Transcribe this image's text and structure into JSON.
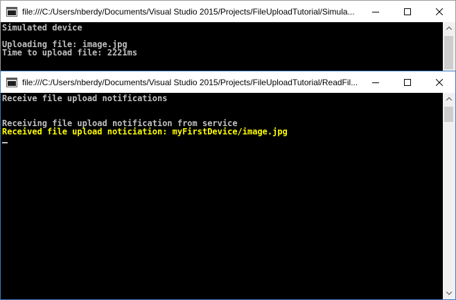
{
  "windows": [
    {
      "title": "file:///C:/Users/nberdy/Documents/Visual Studio 2015/Projects/FileUploadTutorial/Simula...",
      "lines": [
        {
          "text": "Simulated device",
          "color": "#c0c0c0"
        },
        {
          "text": "",
          "color": "#c0c0c0"
        },
        {
          "text": "Uploading file: image.jpg",
          "color": "#c0c0c0"
        },
        {
          "text": "Time to upload file: 2221ms",
          "color": "#c0c0c0"
        }
      ]
    },
    {
      "title": "file:///C:/Users/nberdy/Documents/Visual Studio 2015/Projects/FileUploadTutorial/ReadFil...",
      "lines": [
        {
          "text": "Receive file upload notifications",
          "color": "#c0c0c0"
        },
        {
          "text": "",
          "color": "#c0c0c0"
        },
        {
          "text": "",
          "color": "#c0c0c0"
        },
        {
          "text": "Receiving file upload notification from service",
          "color": "#c0c0c0"
        },
        {
          "text": "Received file upload noticiation: myFirstDevice/image.jpg",
          "color": "#ffff00"
        }
      ]
    }
  ],
  "icons": {
    "app": "console-app-icon",
    "minimize": "minimize-icon",
    "maximize": "maximize-icon",
    "close": "close-icon",
    "scroll_up": "chevron-up-icon",
    "scroll_down": "chevron-down-icon"
  },
  "colors": {
    "console_bg": "#000000",
    "console_text": "#c0c0c0",
    "highlight_text": "#ffff00",
    "active_border": "#3c79c4"
  }
}
